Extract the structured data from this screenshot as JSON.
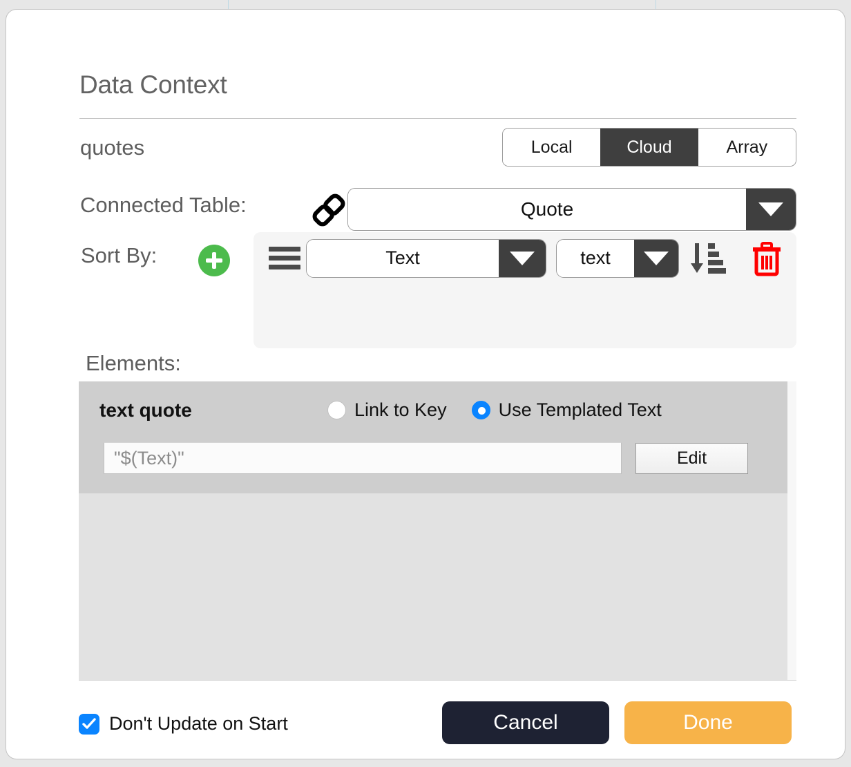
{
  "dialog": {
    "title": "Data Context",
    "context_name": "quotes"
  },
  "source_tabs": {
    "options": [
      "Local",
      "Cloud",
      "Array"
    ],
    "selected": "Cloud"
  },
  "connected_table": {
    "label": "Connected Table:",
    "icon": "chain-link-icon",
    "value": "Quote"
  },
  "sort_by": {
    "label": "Sort By:",
    "add_icon": "plus-circle-icon",
    "rows": [
      {
        "drag_icon": "drag-handle-icon",
        "field": "Text",
        "key": "text",
        "direction_icon": "sort-descending-icon",
        "delete_icon": "trash-icon"
      }
    ]
  },
  "elements": {
    "label": "Elements:",
    "rows": [
      {
        "name": "text quote",
        "mode_options": [
          "Link to Key",
          "Use Templated Text"
        ],
        "mode_selected": "Use Templated Text",
        "template_value": "\"$(Text)\"",
        "edit_label": "Edit"
      }
    ]
  },
  "footer": {
    "checkbox_label": "Don't Update on Start",
    "checkbox_checked": true,
    "cancel_label": "Cancel",
    "done_label": "Done"
  },
  "colors": {
    "accent_blue": "#0a84ff",
    "done_orange": "#f7b349",
    "cancel_navy": "#1e2233",
    "add_green": "#4cbb4c",
    "delete_red": "#ff0000",
    "segment_active": "#3f3f3f"
  }
}
